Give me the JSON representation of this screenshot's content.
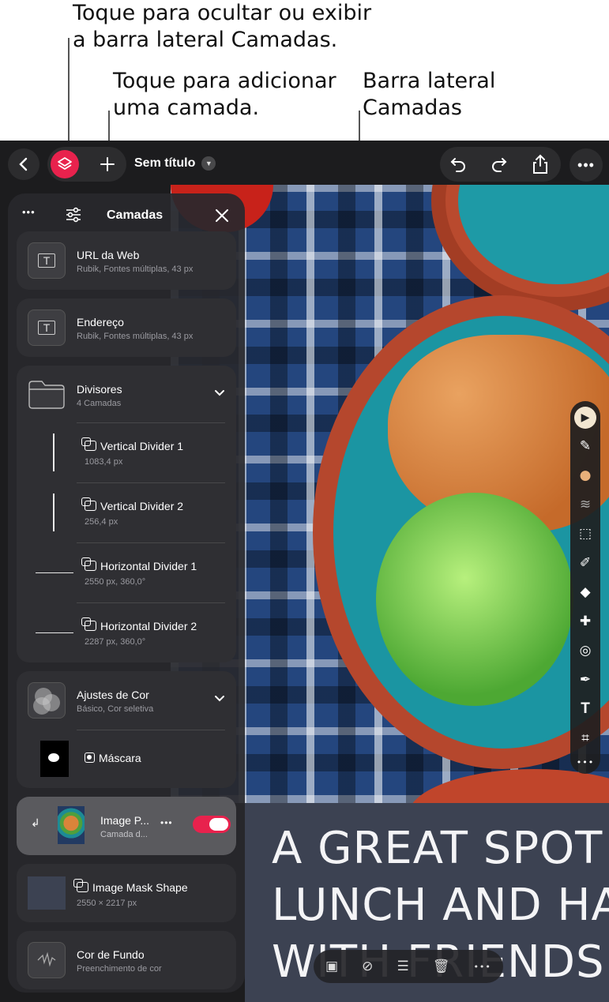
{
  "callouts": {
    "layers_toggle": "Toque para ocultar ou exibir a barra lateral Camadas.",
    "layers_toggle_line1": "Toque para ocultar ou exibir",
    "layers_toggle_line2": "a barra lateral Camadas.",
    "add_layer_line1": "Toque para adicionar",
    "add_layer_line2": "uma camada.",
    "sidebar_line1": "Barra lateral",
    "sidebar_line2": "Camadas"
  },
  "topbar": {
    "document_title": "Sem título",
    "accent_color": "#e8224d"
  },
  "panel": {
    "title": "Camadas",
    "layers": [
      {
        "name": "URL da Web",
        "sub": "Rubik, Fontes múltiplas, 43 px",
        "icon": "text-layer-icon"
      },
      {
        "name": "Endereço",
        "sub": "Rubik, Fontes múltiplas, 43 px",
        "icon": "text-layer-icon"
      }
    ],
    "group": {
      "name": "Divisores",
      "sub": "4 Camadas",
      "children": [
        {
          "name": "Vertical Divider 1",
          "sub": "1083,4 px"
        },
        {
          "name": "Vertical Divider 2",
          "sub": "256,4 px"
        },
        {
          "name": "Horizontal Divider 1",
          "sub": "2550 px, 360,0°"
        },
        {
          "name": "Horizontal Divider 2",
          "sub": "2287 px, 360,0°"
        }
      ]
    },
    "adjustments": {
      "name": "Ajustes de Cor",
      "sub": "Básico, Cor seletiva",
      "mask_label": "Máscara"
    },
    "selected": {
      "name": "Image P...",
      "sub": "Camada d...",
      "toggle_on": true
    },
    "mask_shape": {
      "name": "Image Mask Shape",
      "sub": "2550 × 2217 px"
    },
    "background": {
      "name": "Cor de Fundo",
      "sub": "Preenchimento de cor"
    }
  },
  "canvas": {
    "headline_lines": [
      "A GREAT SPOT",
      "LUNCH AND HA",
      "WITH FRIENDS"
    ]
  },
  "tools": [
    "select-tool-icon",
    "pin-icon",
    "color-icon",
    "blur-icon",
    "marquee-icon",
    "brush-icon",
    "eraser-icon",
    "bandage-icon",
    "clone-icon",
    "pen-icon",
    "text-tool-icon",
    "crop-icon",
    "more-icon"
  ]
}
